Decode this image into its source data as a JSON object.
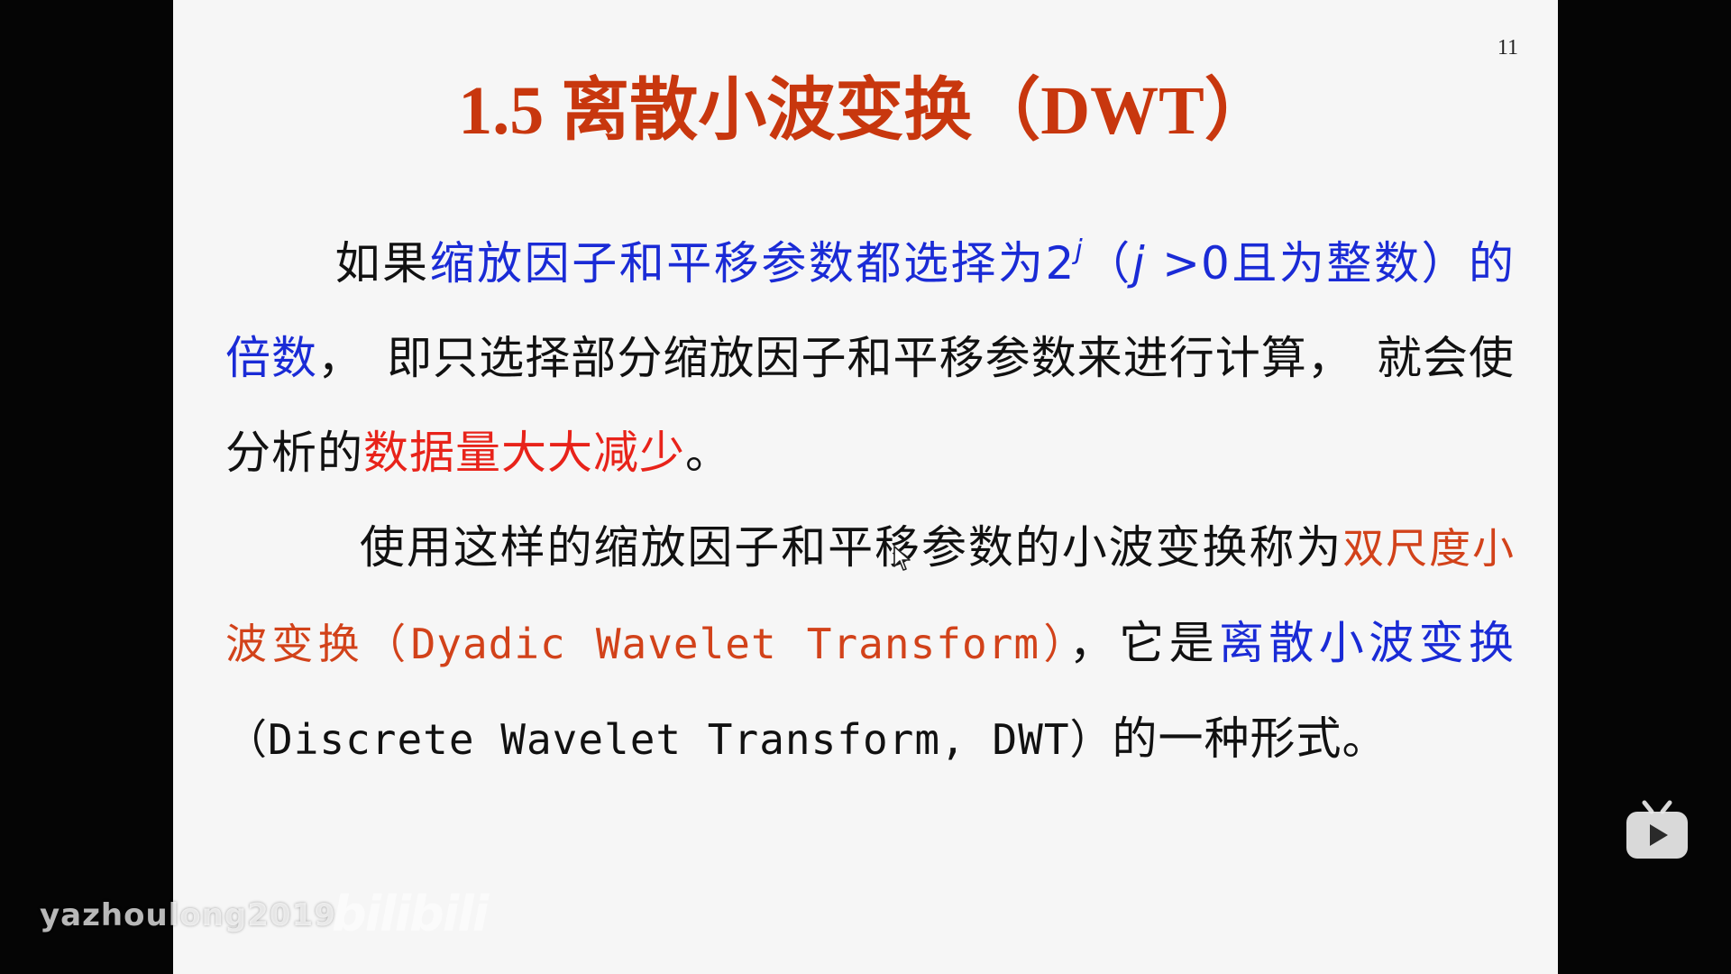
{
  "slide": {
    "page_number": "11",
    "title": "1.5 离散小波变换（DWT）",
    "paragraph1": {
      "lead": "如果",
      "blue_span": "缩放因子和平移参数都选择为2",
      "exponent": "j",
      "paren_open": "（",
      "j_var": "j",
      "condition": " >0且为整数）的倍数",
      "rest_a": "，　即只选择部分缩放因子和平移参数来进行计算，　就会使分析的",
      "red_span": "数据量大大减少",
      "end": "。"
    },
    "paragraph2": {
      "lead": "使用这样的缩放因子和平移参数的小波变换称为",
      "orange_span": "双尺度小波变换（Dyadic Wavelet Transform）",
      "mid": "，它是",
      "blue_span": "离散小波变换",
      "english": "（Discrete Wavelet Transform, DWT）",
      "end": "的一种形式。"
    }
  },
  "overlay": {
    "watermark_user": "yazhoulong2019",
    "platform_logo": "bilibili",
    "tv_icon": "bilibili-tv-icon"
  },
  "colors": {
    "title": "#c8370e",
    "blue": "#1a2bd6",
    "red": "#e8231a",
    "orange": "#d2421a",
    "slide_bg": "#f6f6f6",
    "frame_bg": "#050505"
  }
}
